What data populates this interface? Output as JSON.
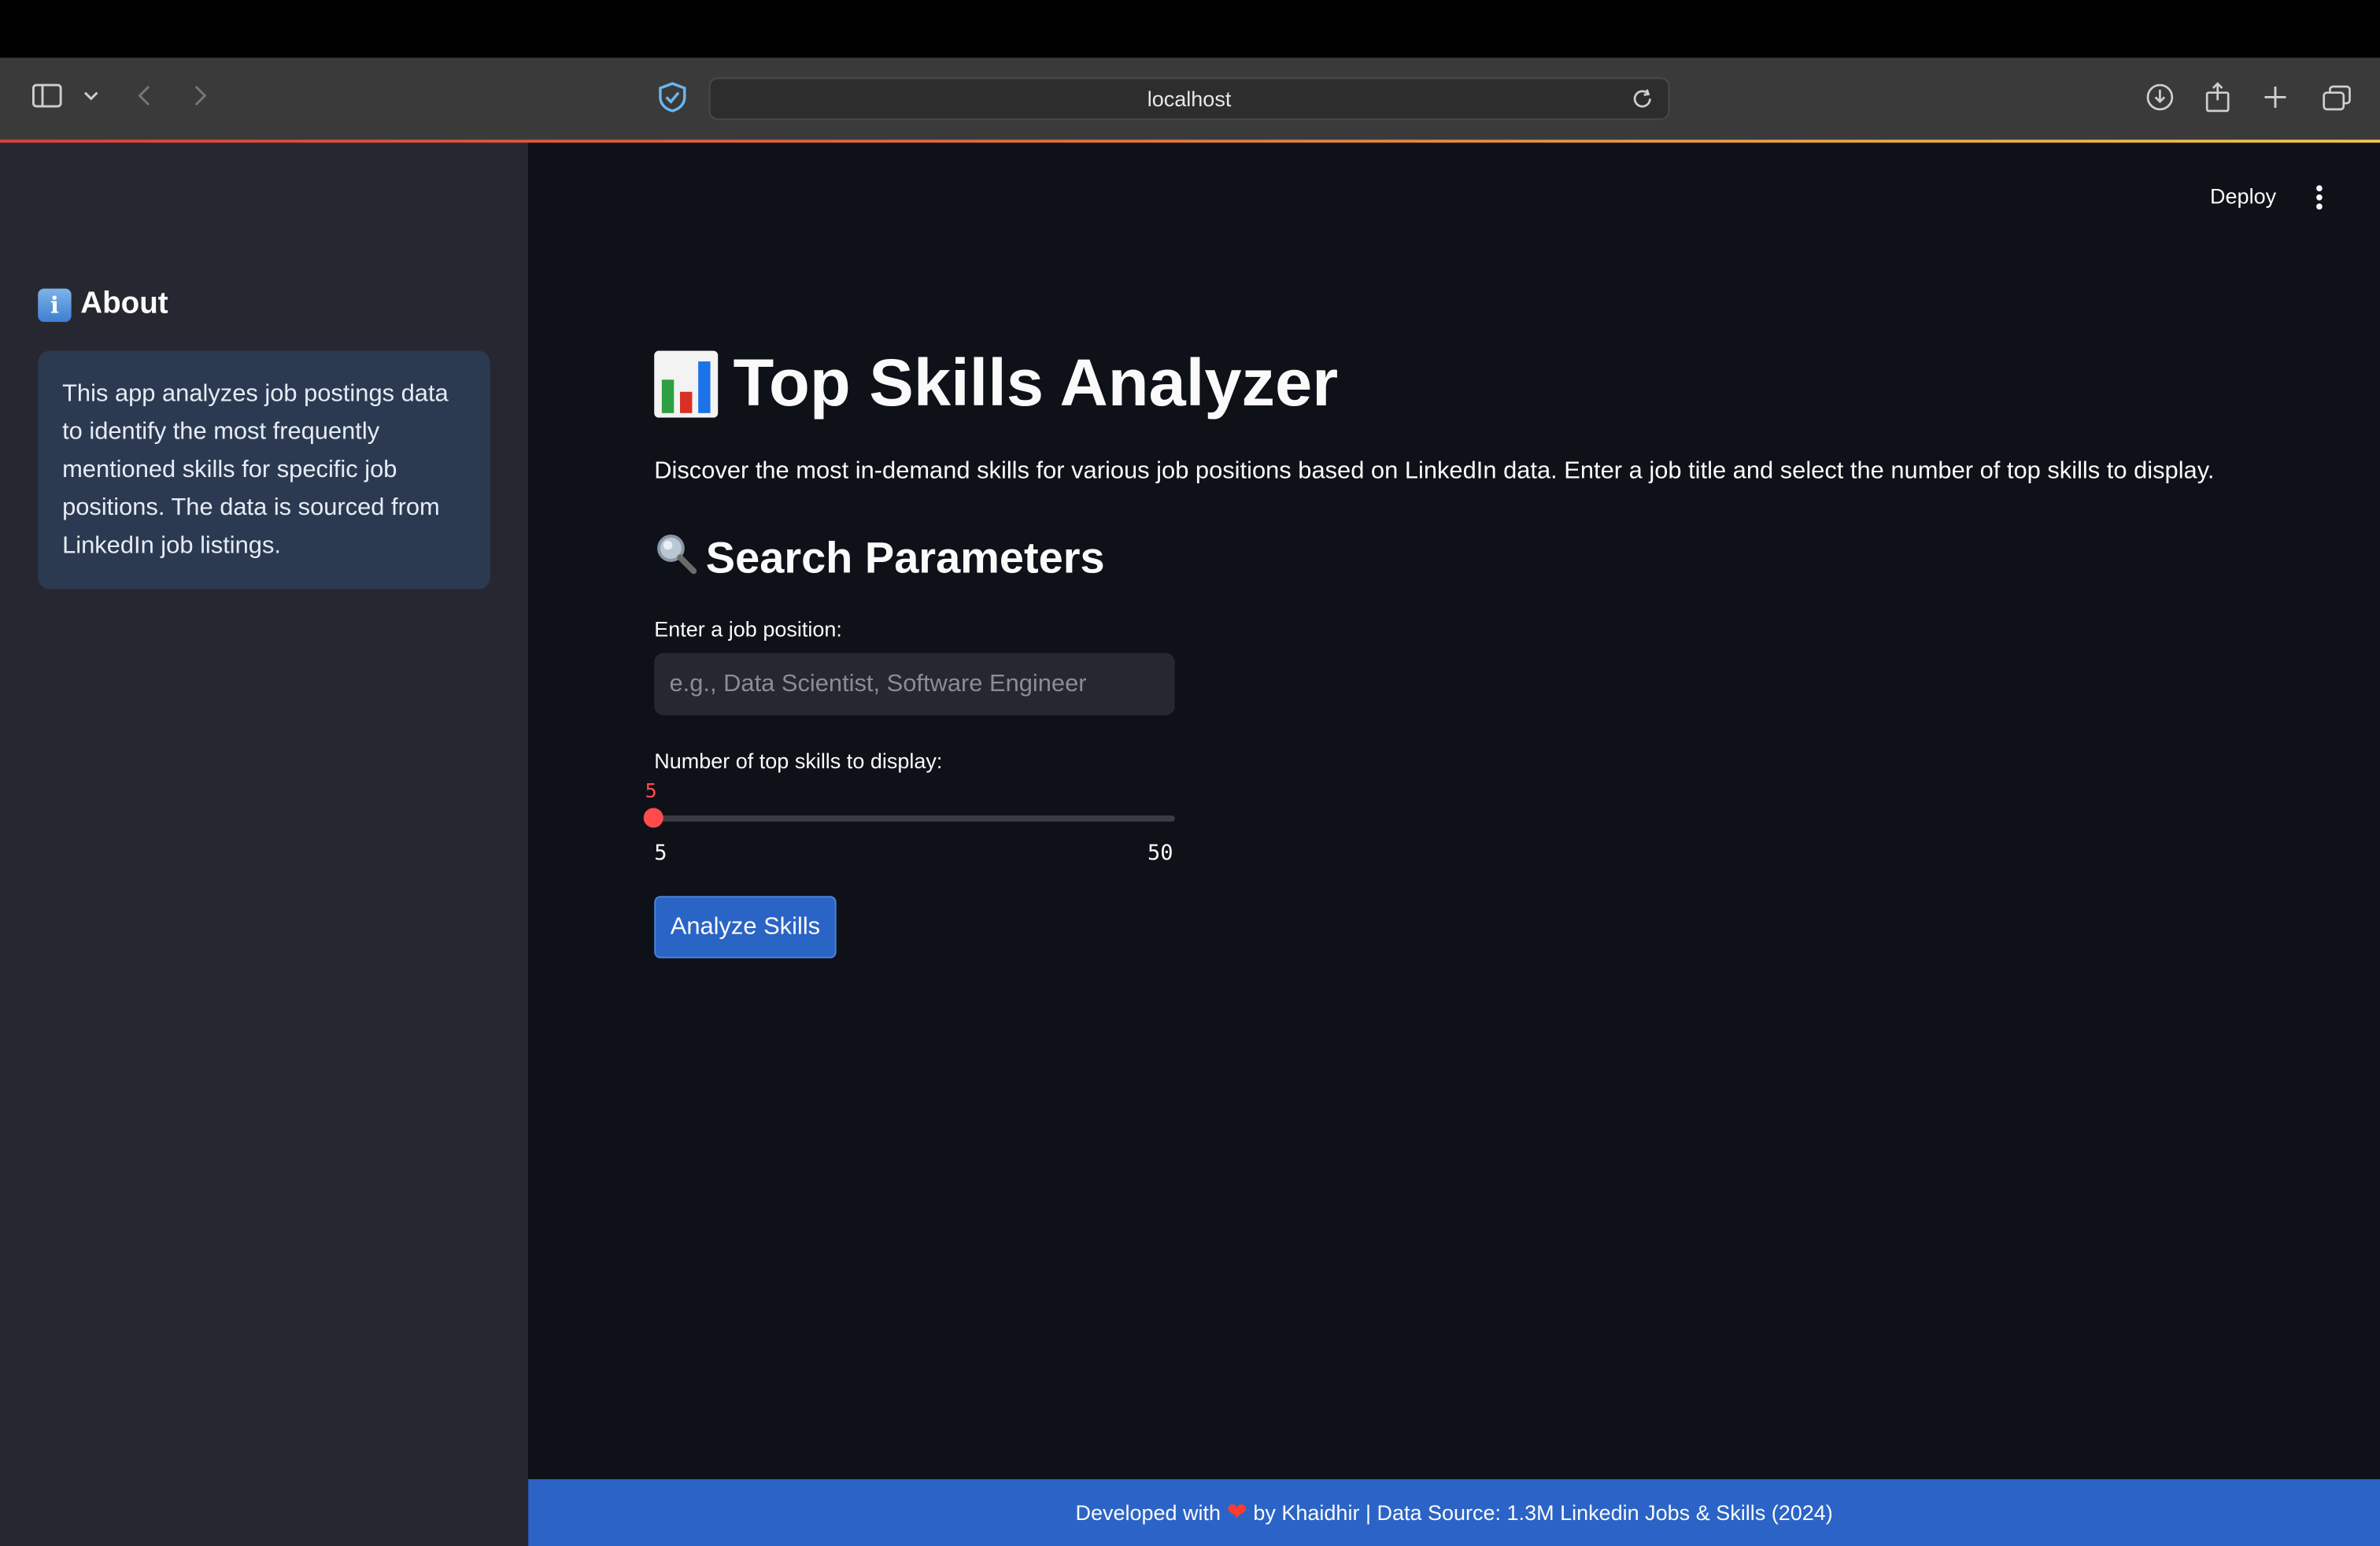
{
  "browser": {
    "url": "localhost"
  },
  "header": {
    "deploy_label": "Deploy"
  },
  "sidebar": {
    "about_title": "About",
    "about_text": "This app analyzes job postings data to identify the most frequently mentioned skills for specific job positions. The data is sourced from LinkedIn job listings."
  },
  "main": {
    "title": "Top Skills Analyzer",
    "description": "Discover the most in-demand skills for various job positions based on LinkedIn data. Enter a job title and select the number of top skills to display.",
    "search_heading": "Search Parameters",
    "job_label": "Enter a job position:",
    "job_placeholder": "e.g., Data Scientist, Software Engineer",
    "job_value": "",
    "slider_label": "Number of top skills to display:",
    "slider_value": "5",
    "slider_min": "5",
    "slider_max": "50",
    "analyze_button": "Analyze Skills"
  },
  "footer": {
    "prefix": "Developed with",
    "suffix": "by Khaidhir | Data Source: 1.3M Linkedin Jobs & Skills (2024)"
  },
  "colors": {
    "sidebar_bg": "#262730",
    "main_bg": "#0e1117",
    "accent_red": "#ff4b4b",
    "button_blue": "#2a64c5",
    "footer_blue": "#2b64c6"
  }
}
